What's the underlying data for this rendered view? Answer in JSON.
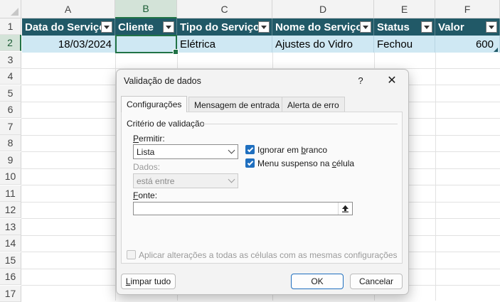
{
  "sheet": {
    "columns": [
      "A",
      "B",
      "C",
      "D",
      "E",
      "F"
    ],
    "rows": [
      "1",
      "2",
      "3",
      "4",
      "5",
      "6",
      "7",
      "8",
      "9",
      "10",
      "11",
      "12",
      "13",
      "14",
      "15",
      "16",
      "17"
    ],
    "headers": [
      "Data do Serviço",
      "Cliente",
      "Tipo do Serviço",
      "Nome do Serviço",
      "Status",
      "Valor"
    ],
    "row2": [
      "18/03/2024",
      "",
      "Elétrica",
      "Ajustes do Vidro",
      "Fechou",
      "600"
    ],
    "selected_column": "B",
    "selected_row": "2"
  },
  "colors": {
    "table_header": "#215967",
    "table_row": "#cfe8f3",
    "selection": "#217346",
    "checkbox": "#1f6fbf"
  },
  "dialog": {
    "title": "Validação de dados",
    "help": "?",
    "close": "✕",
    "tabs": [
      "Configurações",
      "Mensagem de entrada",
      "Alerta de erro"
    ],
    "active_tab": "Configurações",
    "group_label": "Critério de validação",
    "permitir_label_u": "P",
    "permitir_label_rest": "ermitir:",
    "permitir_value": "Lista",
    "dados_label": "Dados:",
    "dados_value": "está entre",
    "ignorar_pre": "Ignorar em ",
    "ignorar_u": "b",
    "ignorar_post": "ranco",
    "ignorar_checked": true,
    "menu_pre": "Menu suspenso na ",
    "menu_u": "c",
    "menu_post": "élula",
    "menu_checked": true,
    "fonte_label_u": "F",
    "fonte_label_rest": "onte:",
    "fonte_value": "",
    "apply_all": "Aplicar alterações a todas as células com as mesmas configurações",
    "apply_all_checked": false,
    "clear_btn_u": "L",
    "clear_btn_rest": "impar tudo",
    "ok": "OK",
    "cancel": "Cancelar"
  },
  "icons": {
    "ref_button": "collapse-dialog-arrow-icon",
    "filter": "filter-dropdown-icon"
  }
}
